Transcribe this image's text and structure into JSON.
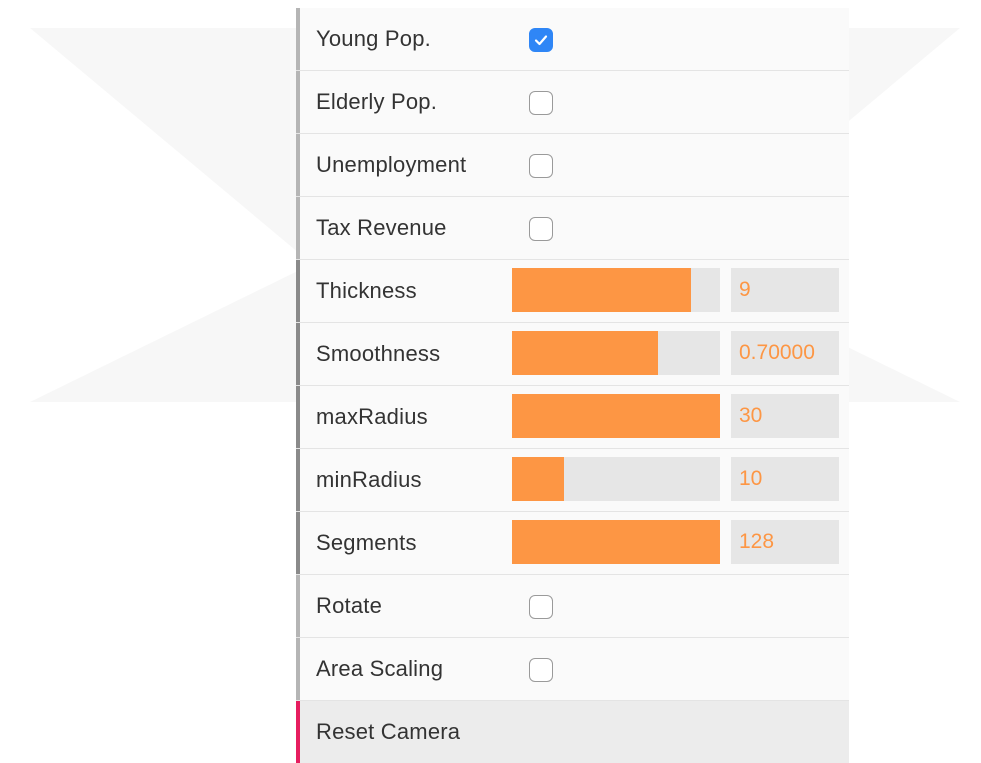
{
  "colors": {
    "accent_orange": "#fd9644",
    "checkbox_blue": "#2f86f6",
    "button_accent": "#e61d5f",
    "track_gray": "#e6e6e6"
  },
  "controls": {
    "young_pop": {
      "label": "Young Pop.",
      "checked": true
    },
    "elderly_pop": {
      "label": "Elderly Pop.",
      "checked": false
    },
    "unemployment": {
      "label": "Unemployment",
      "checked": false
    },
    "tax_revenue": {
      "label": "Tax Revenue",
      "checked": false
    },
    "thickness": {
      "label": "Thickness",
      "value": "9",
      "fill_fraction": 0.86
    },
    "smoothness": {
      "label": "Smoothness",
      "value": "0.70000",
      "fill_fraction": 0.7
    },
    "max_radius": {
      "label": "maxRadius",
      "value": "30",
      "fill_fraction": 1.0
    },
    "min_radius": {
      "label": "minRadius",
      "value": "10",
      "fill_fraction": 0.25
    },
    "segments": {
      "label": "Segments",
      "value": "128",
      "fill_fraction": 1.0
    },
    "rotate": {
      "label": "Rotate",
      "checked": false
    },
    "area_scaling": {
      "label": "Area Scaling",
      "checked": false
    },
    "reset_camera": {
      "label": "Reset Camera"
    }
  }
}
